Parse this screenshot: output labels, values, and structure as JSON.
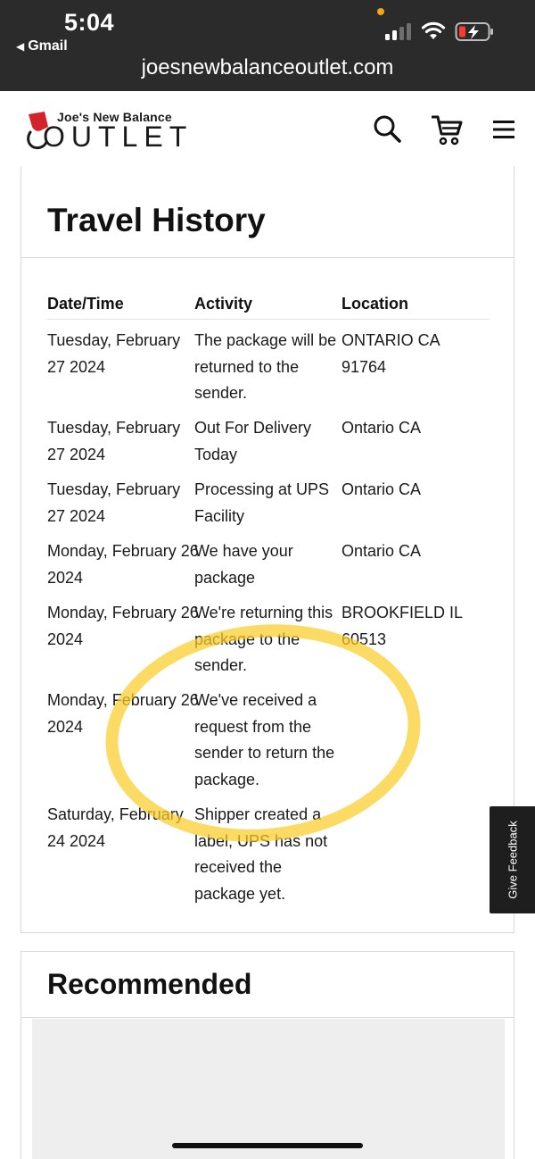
{
  "status_bar": {
    "time": "5:04",
    "back_app": "Gmail",
    "url": "joesnewbalanceoutlet.com"
  },
  "site": {
    "logo_line1": "Joe's New Balance",
    "logo_line2": "OUTLET"
  },
  "icons": [
    "search-icon",
    "cart-icon",
    "menu-icon",
    "wifi-icon",
    "battery-charging-icon",
    "signal-icon",
    "back-arrow-icon"
  ],
  "travel_history": {
    "title": "Travel History",
    "headers": {
      "date": "Date/Time",
      "activity": "Activity",
      "location": "Location"
    },
    "rows": [
      {
        "date": "Tuesday, February 27 2024",
        "activity": "The package will be returned to the sender.",
        "location": "ONTARIO CA 91764"
      },
      {
        "date": "Tuesday, February 27 2024",
        "activity": "Out For Delivery Today",
        "location": "Ontario CA"
      },
      {
        "date": "Tuesday, February 27 2024",
        "activity": "Processing at UPS Facility",
        "location": "Ontario CA"
      },
      {
        "date": "Monday, February 26 2024",
        "activity": "We have your package",
        "location": "Ontario CA"
      },
      {
        "date": "Monday, February 26 2024",
        "activity": "We're returning this package to the sender.",
        "location": "BROOKFIELD IL 60513"
      },
      {
        "date": "Monday, February 26 2024",
        "activity": "We've received a request from the sender to return the package.",
        "location": ""
      },
      {
        "date": "Saturday, February 24 2024",
        "activity": "Shipper created a label, UPS has not received the package yet.",
        "location": ""
      }
    ]
  },
  "feedback_tab": "Give Feedback",
  "recommended": {
    "title": "Recommended"
  },
  "colors": {
    "highlight": "#facd28",
    "topbar": "#2b2b2b",
    "logo_red": "#d2232a"
  }
}
